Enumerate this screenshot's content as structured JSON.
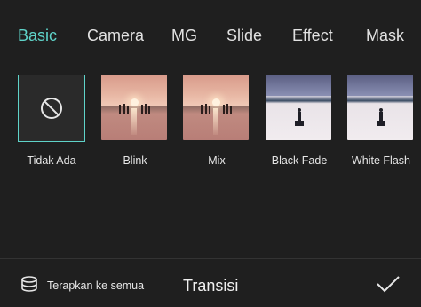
{
  "tabs": [
    {
      "label": "Basic",
      "active": true
    },
    {
      "label": "Camera",
      "active": false
    },
    {
      "label": "MG",
      "active": false
    },
    {
      "label": "Slide",
      "active": false
    },
    {
      "label": "Effect",
      "active": false
    },
    {
      "label": "Mask",
      "active": false
    }
  ],
  "transitions": [
    {
      "label": "Tidak Ada",
      "icon": "no-transition-icon",
      "selected": true
    },
    {
      "label": "Blink",
      "icon": "sunset-thumbnail",
      "selected": false
    },
    {
      "label": "Mix",
      "icon": "sunset-thumbnail",
      "selected": false
    },
    {
      "label": "Black Fade",
      "icon": "lake-thumbnail",
      "selected": false
    },
    {
      "label": "White Flash",
      "icon": "lake-thumbnail",
      "selected": false
    }
  ],
  "bottom": {
    "apply_all_label": "Terapkan ke semua",
    "title": "Transisi",
    "apply_icon": "stack-icon",
    "confirm_icon": "check-icon"
  },
  "colors": {
    "accent": "#5fd3c9",
    "background": "#1f1f1f"
  }
}
